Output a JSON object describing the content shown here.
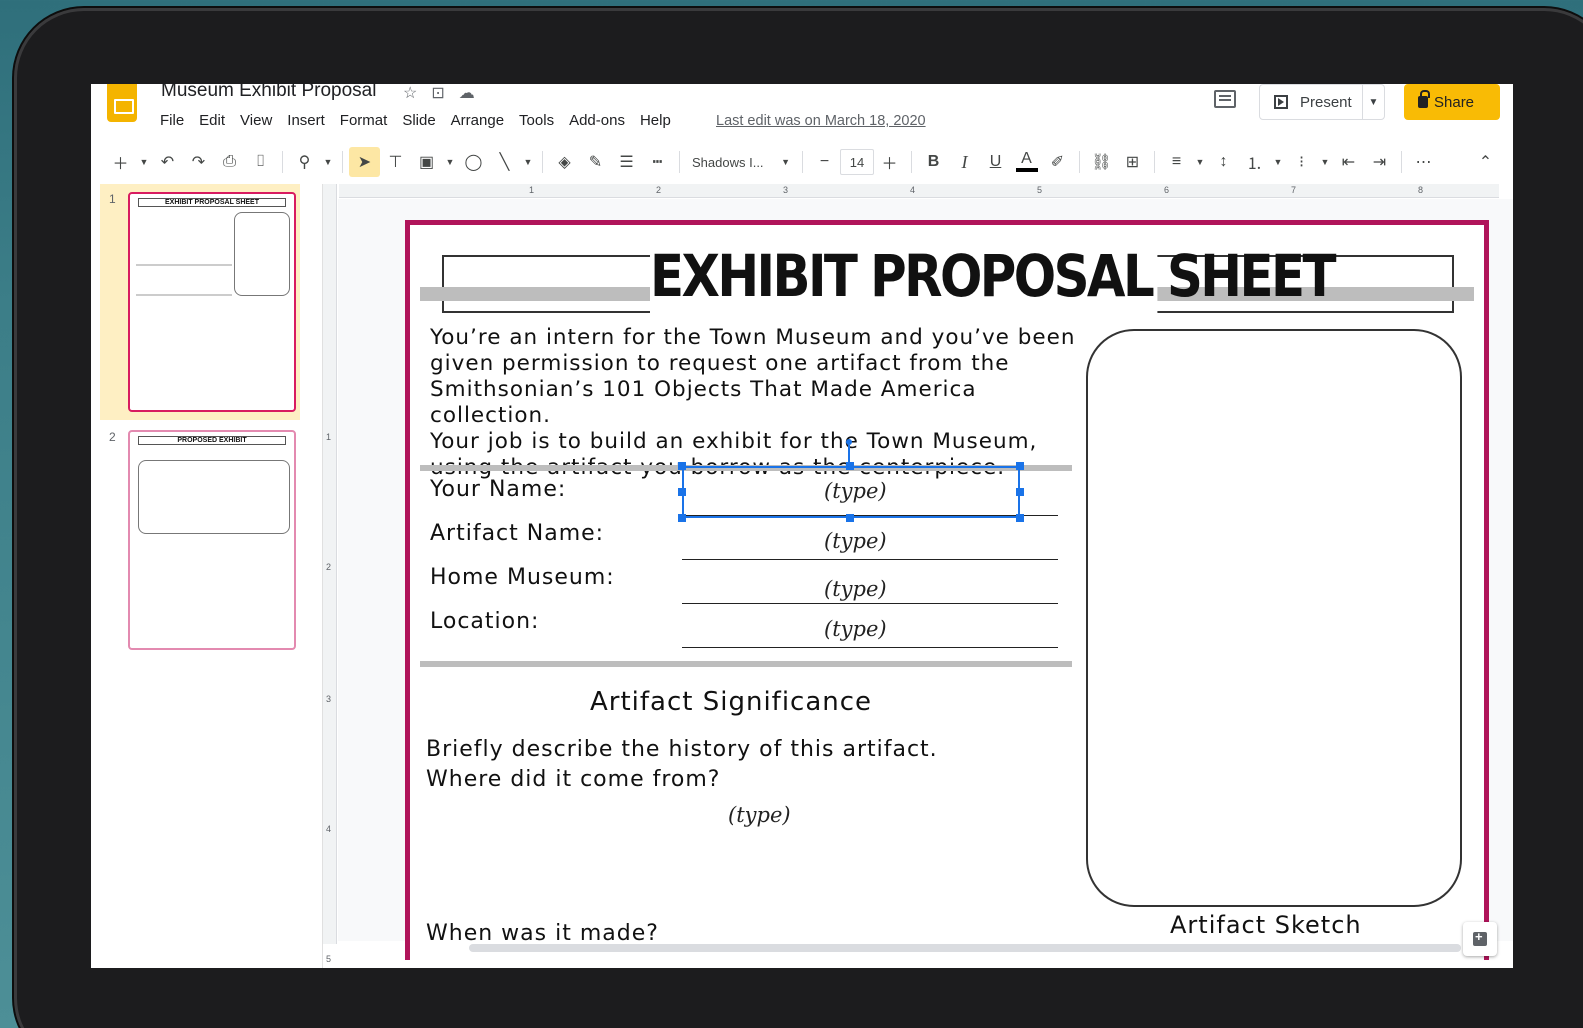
{
  "doc": {
    "title": "Museum Exhibit Proposal",
    "last_edit": "Last edit was on March 18, 2020"
  },
  "menu": [
    "File",
    "Edit",
    "View",
    "Insert",
    "Format",
    "Slide",
    "Arrange",
    "Tools",
    "Add-ons",
    "Help"
  ],
  "header": {
    "present_label": "Present",
    "share_label": "Share"
  },
  "toolbar": {
    "font_name": "Shadows I...",
    "font_size": "14",
    "bold": "B",
    "italic": "I",
    "underline": "U",
    "text_color": "A"
  },
  "ruler": {
    "h_marks": [
      "1",
      "2",
      "3",
      "4",
      "5",
      "6",
      "7",
      "8"
    ],
    "v_marks": [
      "1",
      "2",
      "3",
      "4",
      "5"
    ]
  },
  "filmstrip": {
    "slides": [
      {
        "number": "1",
        "title": "EXHIBIT PROPOSAL SHEET"
      },
      {
        "number": "2",
        "title": "PROPOSED EXHIBIT"
      }
    ]
  },
  "slide": {
    "heading": "EXHIBIT PROPOSAL SHEET",
    "intro_lines": [
      "You’re an intern for the Town Museum and you’ve been",
      "given permission to request one artifact from the",
      "Smithsonian’s 101 Objects That Made America collection.",
      "Your job is to build an exhibit for the Town Museum,",
      "using the artifact you borrow as the centerpiece."
    ],
    "fields": [
      {
        "label": "Your Name:",
        "value": "(type)"
      },
      {
        "label": "Artifact Name:",
        "value": "(type)"
      },
      {
        "label": "Home Museum:",
        "value": "(type)"
      },
      {
        "label": "Location:",
        "value": "(type)"
      }
    ],
    "section_title": "Artifact Significance",
    "question1_lines": [
      "Briefly describe the history of this artifact.",
      "Where did it come from?"
    ],
    "question1_value": "(type)",
    "question2": "When was it made?",
    "sketch_label": "Artifact Sketch"
  },
  "colors": {
    "slide_border": "#b0145a",
    "share_button": "#f9bb05",
    "app_logo": "#f4b400",
    "selection": "#1a73e8",
    "selected_thumb_bg": "#feefc3"
  }
}
